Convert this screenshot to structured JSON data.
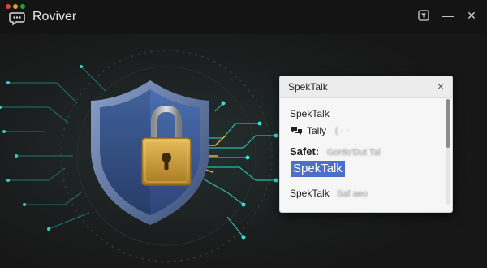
{
  "window": {
    "title": "Roviver",
    "traffic_colors": [
      "#e0443e",
      "#dea123",
      "#1aab29"
    ],
    "controls": [
      "filter-icon",
      "minimize-icon",
      "close-icon"
    ],
    "control_glyphs": {
      "minimize": "—",
      "close": "✕"
    }
  },
  "background": {
    "description_icon": "shield-padlock-icon",
    "shield_color": "#3d5c96",
    "lock_color": "#c99d3a",
    "circuit_color": "#1ea7a0"
  },
  "popup": {
    "title": "SpekTalk",
    "close_glyph": "×",
    "items": [
      {
        "text": "SpekTalk"
      },
      {
        "icon": "chat-bubbles-icon",
        "text": "Tally",
        "blurred": "(  ·  ·"
      },
      {
        "text": "Safet:",
        "blurred": "Gortlo'Dut  Tal"
      },
      {
        "text": "SpekTalk",
        "selected": true
      },
      {
        "text": "SpekTalk",
        "blurred": "Saf  aeo"
      }
    ],
    "selection_color": "#4d6fc9"
  }
}
